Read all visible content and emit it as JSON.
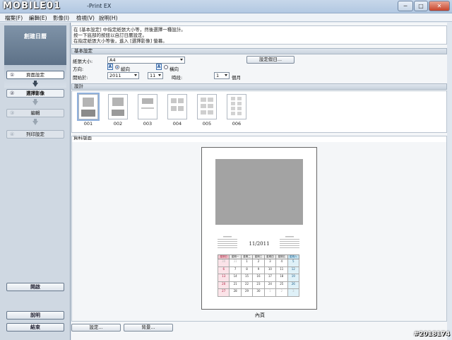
{
  "window": {
    "logo_text": "MOBILE01",
    "title": "-Print EX",
    "minimize_label": "─",
    "maximize_label": "□",
    "close_label": "✕"
  },
  "menu": [
    {
      "label": "檔案(F)"
    },
    {
      "label": "編輯(E)"
    },
    {
      "label": "影像(I)"
    },
    {
      "label": "檢視(V)"
    },
    {
      "label": "說明(H)"
    }
  ],
  "sidebar": {
    "header": "創建日曆",
    "steps": [
      {
        "num": "①",
        "label": "頁面設定",
        "state": "current"
      },
      {
        "num": "②",
        "label": "選擇影像",
        "state": "enabled"
      },
      {
        "num": "③",
        "label": "編輯",
        "state": "disabled"
      },
      {
        "num": "④",
        "label": "列印設定",
        "state": "disabled"
      }
    ],
    "open_button": "開啟",
    "help_button": "說明",
    "exit_button": "結束"
  },
  "instructions": [
    "在 [基本設定] 中指定紙張大小等，然後選擇一種設計。",
    "按一下底部的按鈕以自訂日曆設定。",
    "在指定紙張大小等後，進入 [選擇影像] 螢幕。"
  ],
  "basic_settings": {
    "heading": "基本設定",
    "paper_size_label": "紙張大小:",
    "paper_size_value": "A4",
    "set_holidays_button": "設定假日...",
    "orientation_label": "方向:",
    "orientation_portrait_icon": "A",
    "orientation_portrait": "縱向",
    "orientation_landscape_icon": "A",
    "orientation_landscape": "橫向",
    "start_label": "開始於:",
    "start_year": "2011",
    "start_month": "11",
    "period_label": "時段:",
    "period_value": "1",
    "period_unit": "個月"
  },
  "design": {
    "heading": "設計",
    "selected": "001",
    "items": [
      "001",
      "002",
      "003",
      "004",
      "005",
      "006"
    ]
  },
  "preview": {
    "heading": "資料版面",
    "month_title": "11/2011",
    "weekday_headers": [
      "星期日",
      "星期一",
      "星期二",
      "星期三",
      "星期四",
      "星期五",
      "星期六"
    ],
    "weeks": [
      [
        "30",
        "31",
        "1",
        "2",
        "3",
        "4",
        "5"
      ],
      [
        "6",
        "7",
        "8",
        "9",
        "10",
        "11",
        "12"
      ],
      [
        "13",
        "14",
        "15",
        "16",
        "17",
        "18",
        "19"
      ],
      [
        "20",
        "21",
        "22",
        "23",
        "24",
        "25",
        "26"
      ],
      [
        "27",
        "28",
        "29",
        "30",
        "1",
        "2",
        "3"
      ]
    ],
    "caption": "內頁"
  },
  "bottom_buttons": {
    "settings": "設定...",
    "background": "背景..."
  },
  "watermark": "#2018174"
}
